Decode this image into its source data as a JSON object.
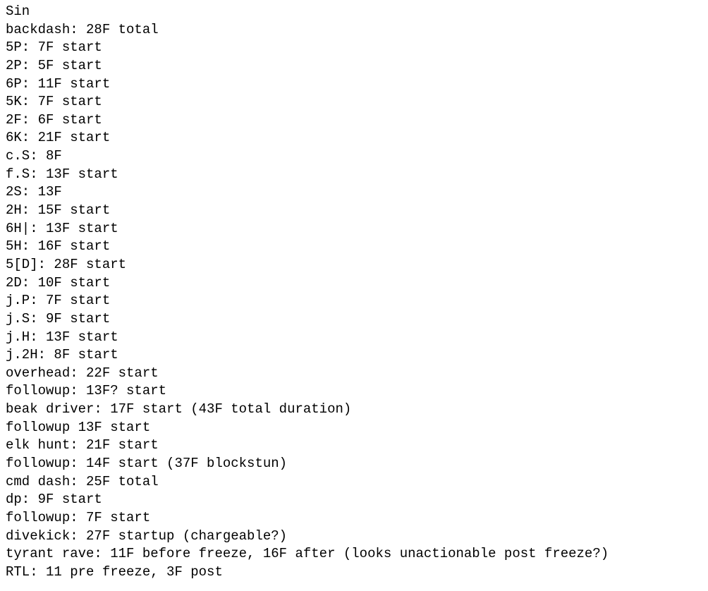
{
  "lines": [
    "Sin",
    "backdash: 28F total",
    "5P: 7F start",
    "2P: 5F start",
    "6P: 11F start",
    "5K: 7F start",
    "2F: 6F start",
    "6K: 21F start",
    "c.S: 8F",
    "f.S: 13F start",
    "2S: 13F",
    "2H: 15F start",
    "6H|: 13F start",
    "5H: 16F start",
    "5[D]: 28F start",
    "2D: 10F start",
    "j.P: 7F start",
    "j.S: 9F start",
    "j.H: 13F start",
    "j.2H: 8F start",
    "overhead: 22F start",
    "followup: 13F? start",
    "beak driver: 17F start (43F total duration)",
    "followup 13F start",
    "elk hunt: 21F start",
    "followup: 14F start (37F blockstun)",
    "cmd dash: 25F total",
    "dp: 9F start",
    "followup: 7F start",
    "divekick: 27F startup (chargeable?)",
    "tyrant rave: 11F before freeze, 16F after (looks unactionable post freeze?)",
    "RTL: 11 pre freeze, 3F post"
  ]
}
